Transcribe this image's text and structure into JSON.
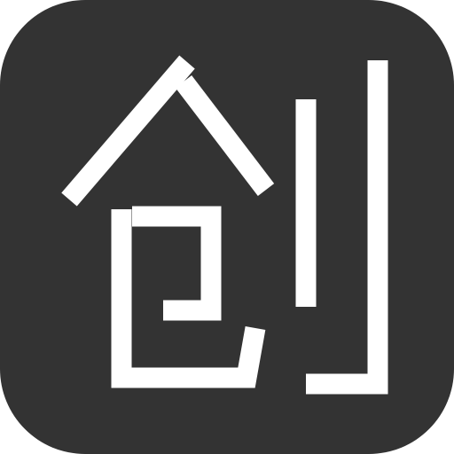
{
  "app_icon": {
    "glyph": "创",
    "background_color": "#333333",
    "glyph_color": "#ffffff"
  }
}
